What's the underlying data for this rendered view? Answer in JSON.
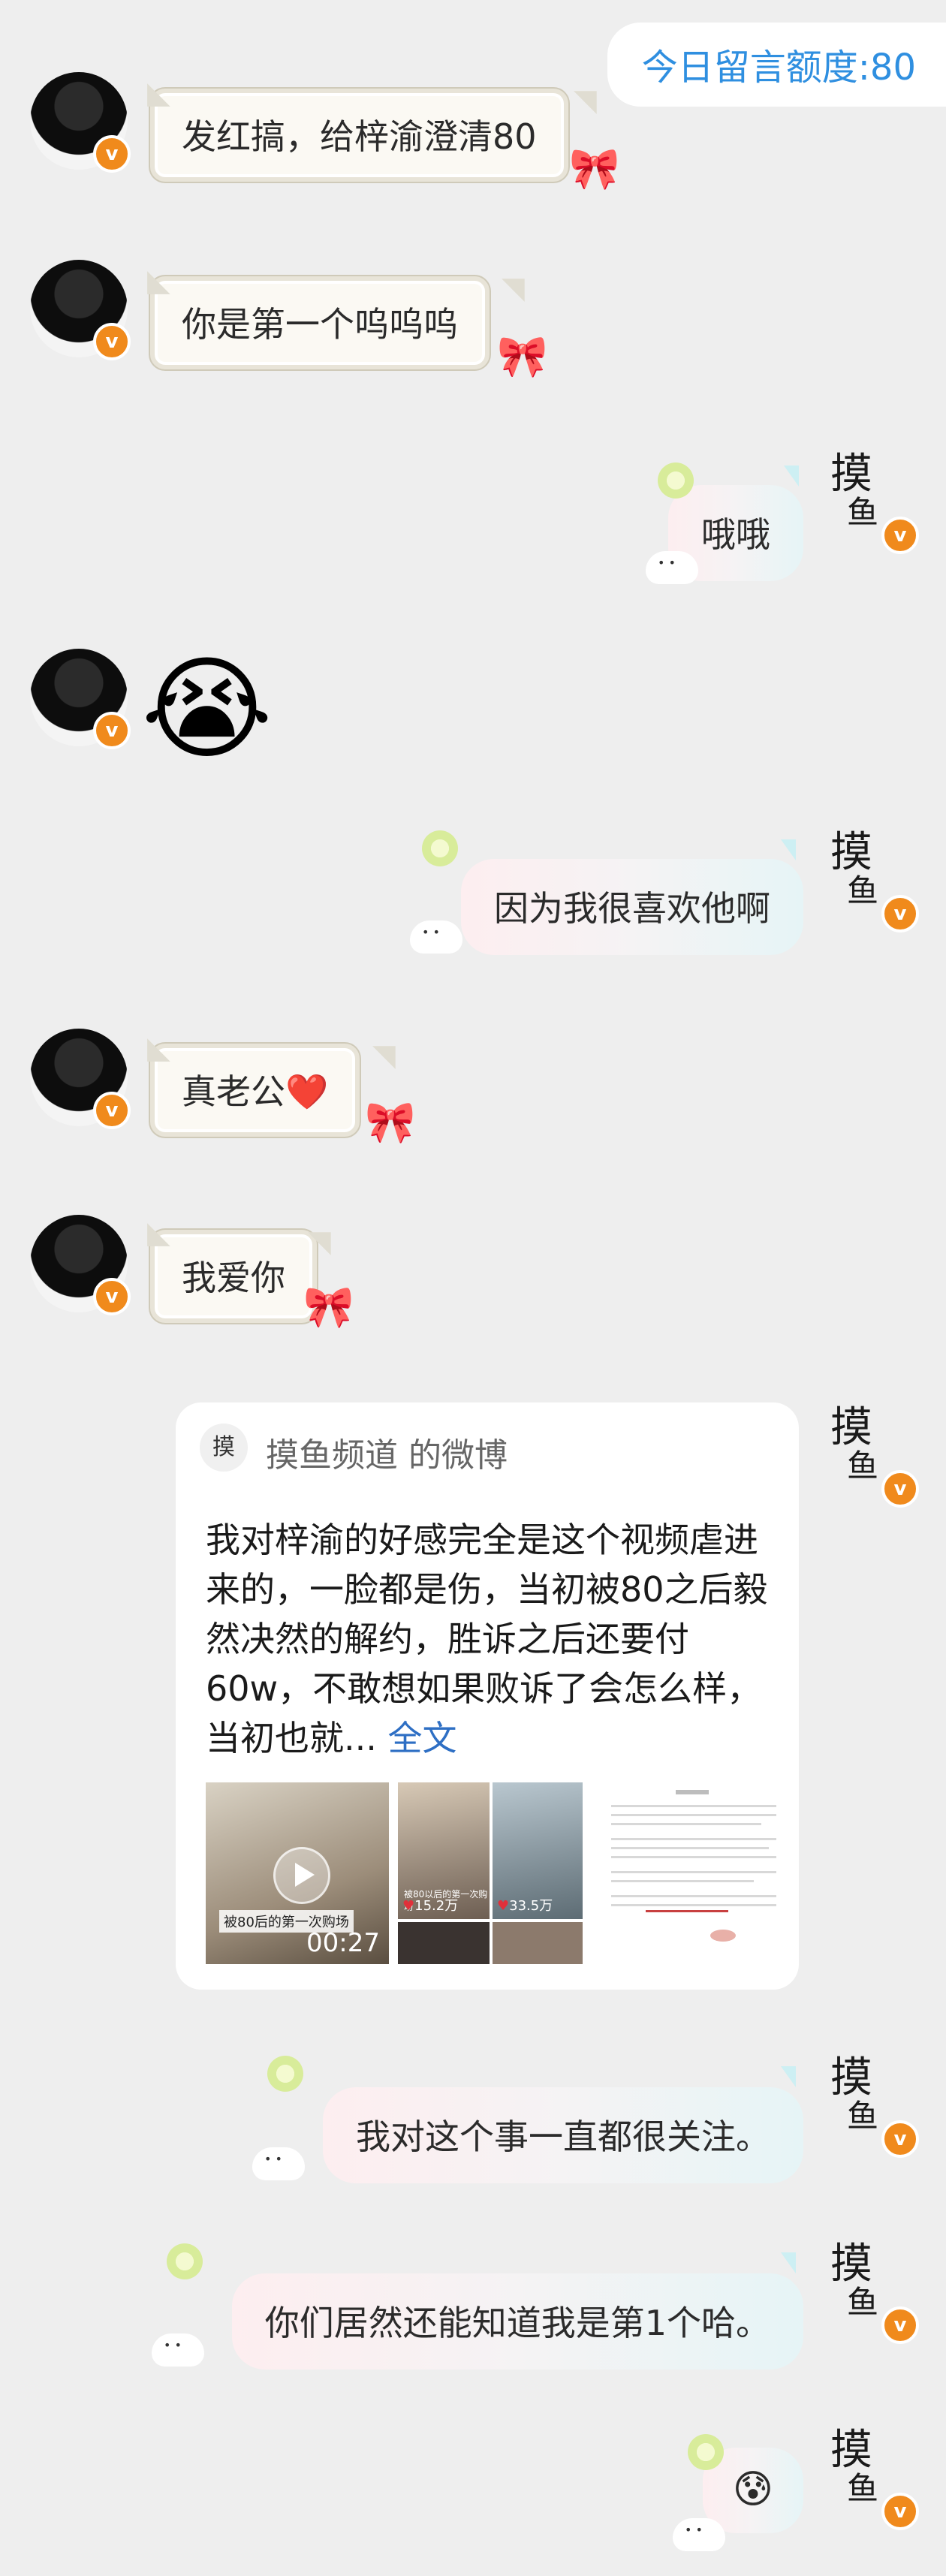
{
  "quota": {
    "label": "今日留言额度:80"
  },
  "messages": [
    {
      "side": "left",
      "text": "发红搞，给梓渝澄清80"
    },
    {
      "side": "left",
      "text": "你是第一个呜呜呜"
    },
    {
      "side": "right",
      "text": "哦哦"
    },
    {
      "side": "left",
      "emoji": "😭"
    },
    {
      "side": "right",
      "text": "因为我很喜欢他啊"
    },
    {
      "side": "left",
      "text": "真老公",
      "emoji": "❤️"
    },
    {
      "side": "left",
      "text": "我爱你"
    },
    {
      "side": "right",
      "text": "我对这个事一直都很关注。"
    },
    {
      "side": "right",
      "text": "你们居然还能知道我是第1个哈。"
    },
    {
      "side": "right",
      "emoji": "😰"
    }
  ],
  "weibo_card": {
    "header": "摸鱼频道 的微博",
    "text": "我对梓渝的好感完全是这个视频虐进来的，一脸都是伤，当初被80之后毅然决然的解约，胜诉之后还要付60w，不敢想如果败诉了会怎么样，当初也就...",
    "more": "全文",
    "video_label": "被80后的第一次购场",
    "video_duration": "00:27",
    "thumb_caption": "被80以后的第一次购场",
    "likes_1": "15.2万",
    "likes_2": "33.5万",
    "logo_text": "摸"
  },
  "avatars": {
    "left_verified": "v",
    "right_logo_top": "摸",
    "right_logo_bottom": "鱼",
    "right_verified": "v"
  },
  "icons": {
    "verified": "verified-badge-icon",
    "bow": "ribbon-bow-icon",
    "lime": "lime-decoration-icon",
    "ghost": "white-ghost-decoration-icon",
    "play": "play-icon"
  },
  "colors": {
    "background": "#eeeeee",
    "quota_text": "#2f8fe0",
    "verified": "#f08a1c",
    "link": "#2e6fc4"
  }
}
